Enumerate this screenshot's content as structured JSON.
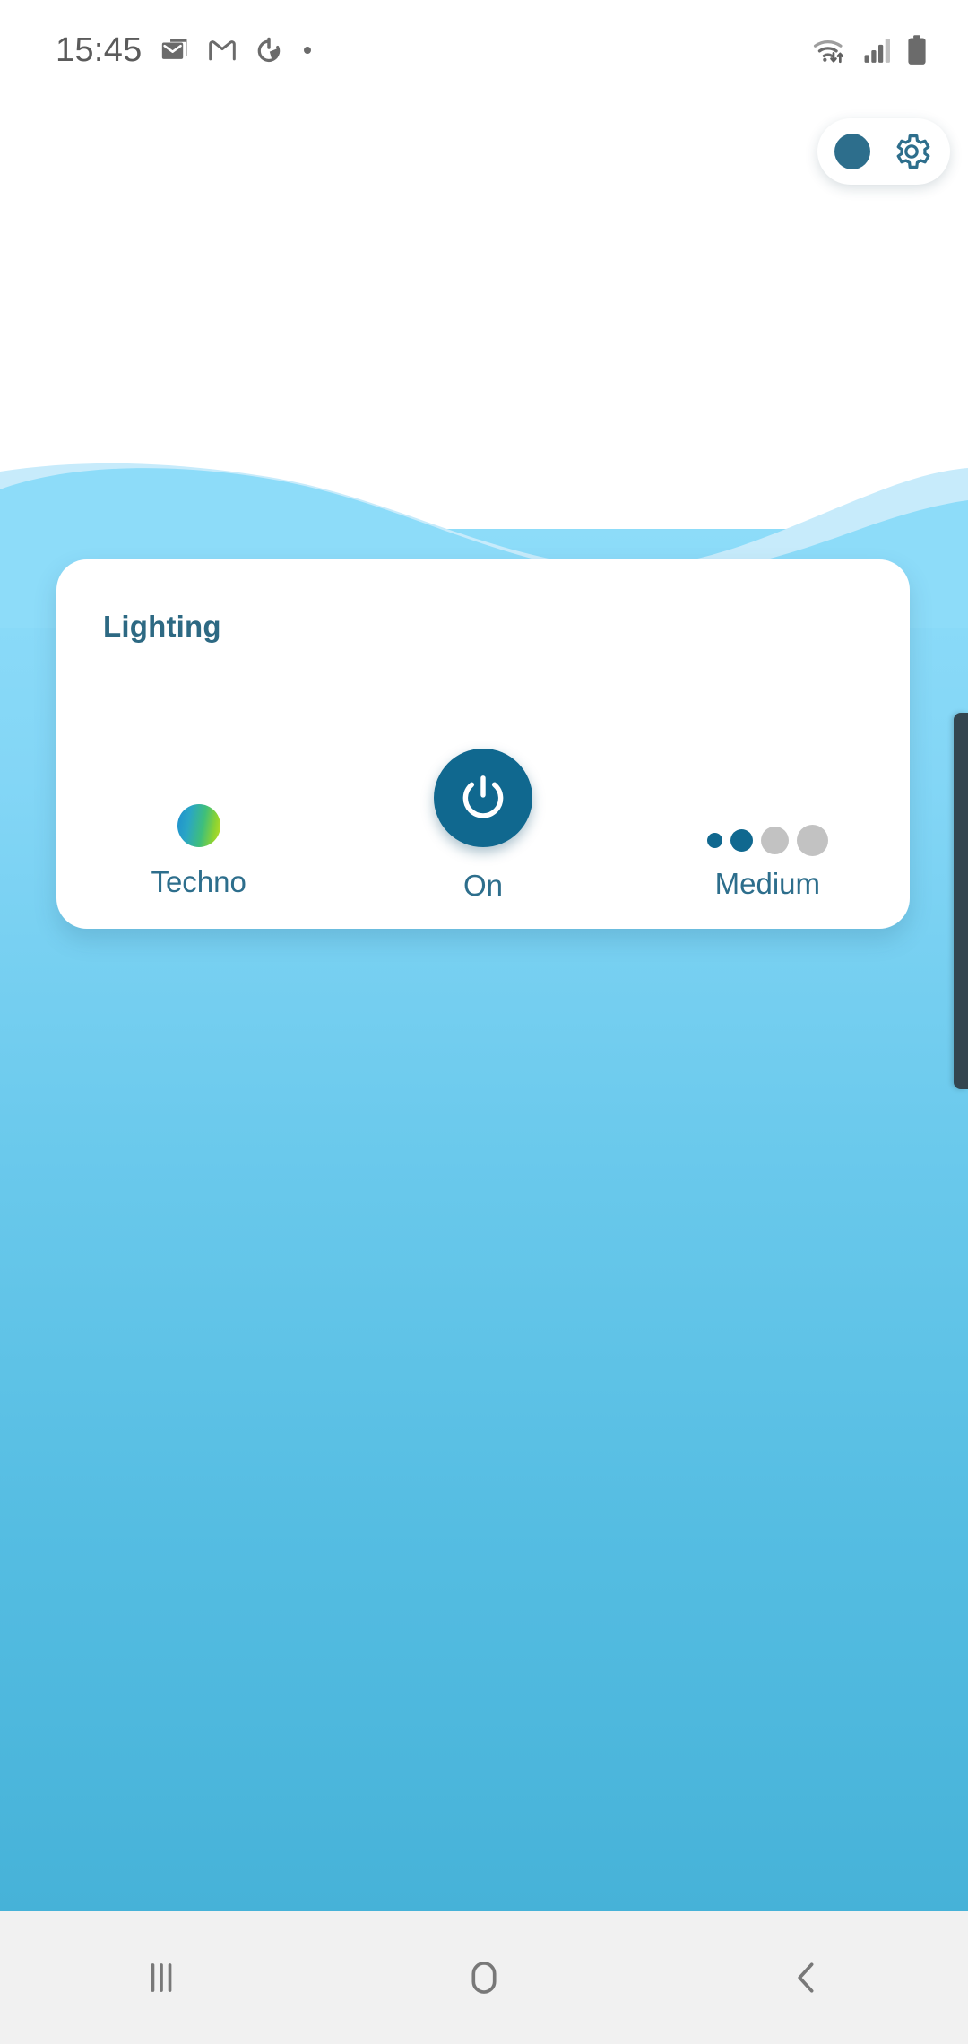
{
  "status_bar": {
    "clock": "15:45",
    "left_icons": [
      {
        "name": "email-icon",
        "label": "Email"
      },
      {
        "name": "gmail-icon",
        "label": "Gmail"
      },
      {
        "name": "power-saving-icon",
        "label": "Power saving"
      },
      {
        "name": "more-notifications-dot-icon",
        "label": "More"
      }
    ],
    "right_icons": [
      {
        "name": "wifi-icon",
        "label": "Wi-Fi"
      },
      {
        "name": "cellular-signal-icon",
        "label": "Signal"
      },
      {
        "name": "battery-icon",
        "label": "Battery"
      }
    ]
  },
  "header": {
    "status_dot_name": "connection-status-dot",
    "settings_icon_name": "gear-icon",
    "settings_label": "Settings"
  },
  "card": {
    "title": "Lighting",
    "controls": {
      "scene": {
        "label": "Techno",
        "icon_name": "scene-color-swatch"
      },
      "power": {
        "label": "On",
        "icon_name": "power-icon",
        "state": "on"
      },
      "brightness": {
        "label": "Medium",
        "level": 2,
        "total_steps": 4,
        "dots": [
          {
            "size": "s1",
            "state": "on"
          },
          {
            "size": "s2",
            "state": "on"
          },
          {
            "size": "s3",
            "state": "off"
          },
          {
            "size": "s4",
            "state": "off"
          }
        ]
      }
    }
  },
  "nav_bar": {
    "buttons": [
      {
        "name": "recents-button",
        "label": "Recents"
      },
      {
        "name": "home-button",
        "label": "Home"
      },
      {
        "name": "back-button",
        "label": "Back"
      }
    ]
  },
  "colors": {
    "accent_teal": "#10688f",
    "title_teal": "#2d6983",
    "label_teal": "#2d6e8c",
    "card_bg": "#ffffff",
    "wave_light": "#bfe8fa",
    "wave_main": "#8ddcf9",
    "bg_bottom": "#46b2d8",
    "nav_bg": "#f1f1f1",
    "dot_inactive": "#c2c2c2",
    "scrollbar": "#33454f"
  }
}
